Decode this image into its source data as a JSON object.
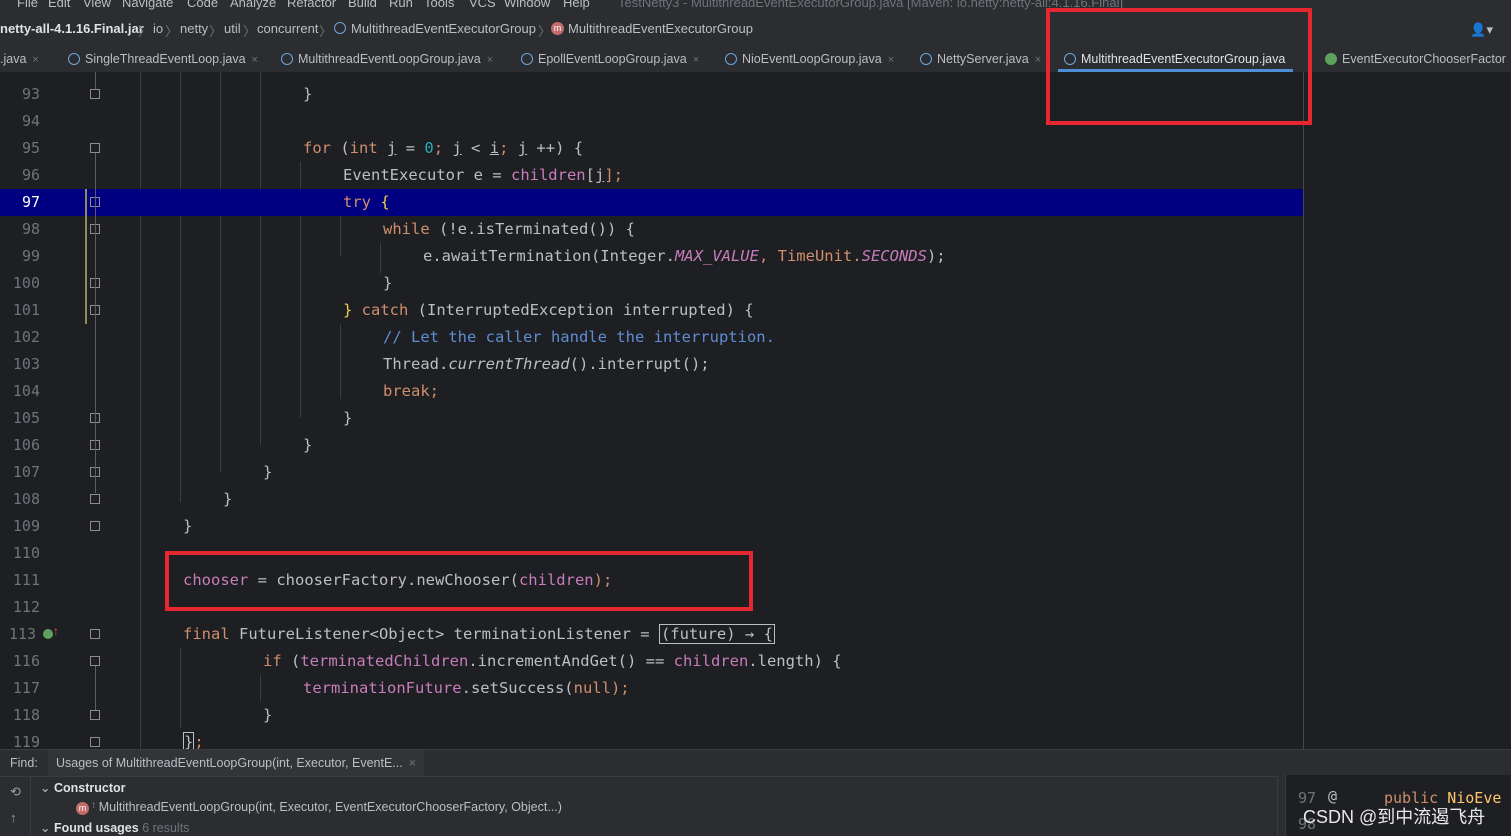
{
  "menu": {
    "items": [
      "File",
      "Edit",
      "View",
      "Navigate",
      "Code",
      "Analyze",
      "Refactor",
      "Build",
      "Run",
      "Tools",
      "VCS",
      "Window",
      "Help"
    ],
    "window_title": "TestNetty3 - MultithreadEventExecutorGroup.java [Maven: io.netty:netty-all:4.1.16.Final]"
  },
  "breadcrumbs": {
    "jar": "netty-all-4.1.16.Final.jar",
    "pkg1": "io",
    "pkg2": "netty",
    "pkg3": "util",
    "pkg4": "concurrent",
    "class": "MultithreadEventExecutorGroup",
    "member": "MultithreadEventExecutorGroup",
    "separator": "〉"
  },
  "tabs": [
    {
      "label": ".java",
      "icon": "class-icon"
    },
    {
      "label": "SingleThreadEventLoop.java",
      "icon": "class-icon"
    },
    {
      "label": "MultithreadEventLoopGroup.java",
      "icon": "class-icon"
    },
    {
      "label": "EpollEventLoopGroup.java",
      "icon": "class-icon"
    },
    {
      "label": "NioEventLoopGroup.java",
      "icon": "class-icon"
    },
    {
      "label": "NettyServer.java",
      "icon": "class-icon"
    },
    {
      "label": "MultithreadEventExecutorGroup.java",
      "icon": "class-icon",
      "active": true
    },
    {
      "label": "EventExecutorChooserFactor",
      "icon": "interface-icon"
    }
  ],
  "close_glyph": "×",
  "editor": {
    "current_line": "97",
    "lines": [
      "93",
      "94",
      "95",
      "96",
      "97",
      "98",
      "99",
      "100",
      "101",
      "102",
      "103",
      "104",
      "105",
      "106",
      "107",
      "108",
      "109",
      "110",
      "111",
      "112",
      "113",
      "116",
      "117",
      "118",
      "119"
    ]
  },
  "code": {
    "l93_brace": "}",
    "l95_for": "for",
    "l95_a": " (",
    "l95_int": "int",
    "l95_sp": " ",
    "l95_j1": "j",
    "l95_eq": " = ",
    "l95_zero": "0",
    "l95_semi": "; ",
    "l95_j2": "j",
    "l95_lt": " < ",
    "l95_i": "i",
    "l95_semi2": "; ",
    "l95_j3": "j",
    "l95_end": " ++) {",
    "l96_type": "EventExecutor e = ",
    "l96_field": "children",
    "l96_br": "[",
    "l96_j": "j",
    "l96_end": "];",
    "l97_try": "try",
    "l97_brace": " {",
    "l98_while": "while",
    "l98_rest": " (!e.isTerminated()) {",
    "l99_a": "e.awaitTermination(Integer.",
    "l99_max": "MAX_VALUE",
    "l99_b": ", TimeUnit.",
    "l99_sec": "SECONDS",
    "l99_c": ");",
    "l100_brace": "}",
    "l101_a": "} ",
    "l101_catch": "catch",
    "l101_rest": " (InterruptedException interrupted) {",
    "l102_comment": "// Let the caller handle the interruption.",
    "l103_a": "Thread.",
    "l103_m": "currentThread",
    "l103_b": "().interrupt();",
    "l104_break": "break",
    "l104_semi": ";",
    "l105_brace": "}",
    "l106_brace": "}",
    "l107_brace": "}",
    "l108_brace": "}",
    "l109_brace": "}",
    "l111_field": "chooser",
    "l111_a": " = ",
    "l111_field2": "chooserFactory",
    "l111_b": ".newChooser(",
    "l111_field3": "children",
    "l111_c": ");",
    "l113_final": "final",
    "l113_a": " FutureListener<Object> terminationListener = ",
    "l113_hint": "(future) → {",
    "l116_if": "if",
    "l116_a": " (",
    "l116_field": "terminatedChildren",
    "l116_b": ".incrementAndGet() == ",
    "l116_field2": "children",
    "l116_c": ".length) {",
    "l117_field": "terminationFuture",
    "l117_a": ".setSuccess(",
    "l117_null": "null",
    "l117_b": ");",
    "l118_brace": "}",
    "l119_a": "}",
    "l119_b": ";"
  },
  "find": {
    "label": "Find:",
    "tab": "Usages of MultithreadEventLoopGroup(int, Executor, EventE...",
    "tree_constructor": "Constructor",
    "tree_method": "MultithreadEventLoopGroup(int, Executor, EventExecutorChooserFactory, Object...)",
    "tree_found": "Found usages",
    "tree_count": "6 results"
  },
  "preview": {
    "line1": "97",
    "line1_at": "@",
    "line1_code_kw": "public",
    "line1_code": " NioEve",
    "line2": "98"
  },
  "watermark": "CSDN @到中流遏飞舟",
  "colors": {
    "highlight": "#000080",
    "annotation_box": "#e6272f",
    "keyword": "#cf8e6d",
    "field": "#c77dbb",
    "number": "#2aacb8",
    "comment": "#5f8dd3"
  }
}
